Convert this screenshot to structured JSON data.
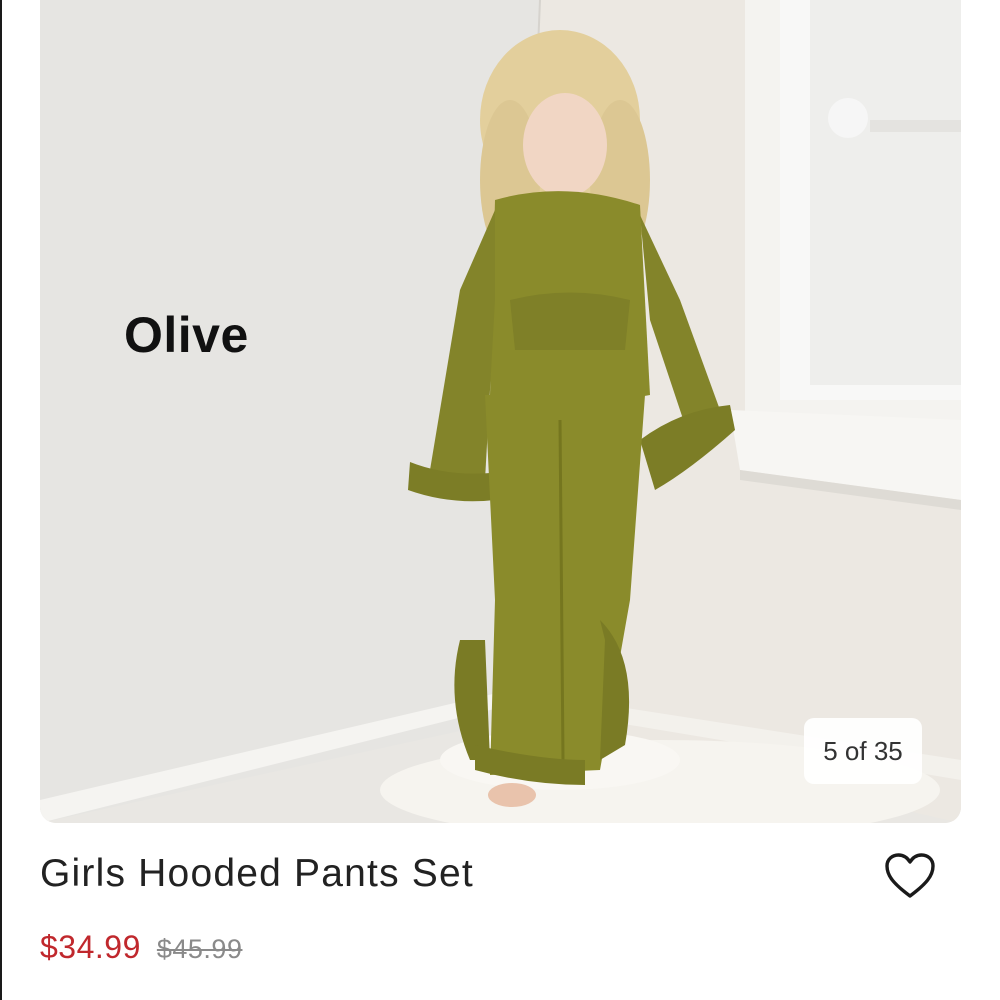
{
  "image": {
    "overlay_text": "Olive",
    "counter": "5 of 35"
  },
  "product": {
    "title": "Girls Hooded Pants Set",
    "sale_price": "$34.99",
    "original_price": "$45.99",
    "favorite_icon": "heart-outline-icon"
  },
  "colors": {
    "sale_price": "#c0282d",
    "original_price": "#8a8a8a",
    "title": "#222222",
    "outfit": "#8a8a2a"
  }
}
